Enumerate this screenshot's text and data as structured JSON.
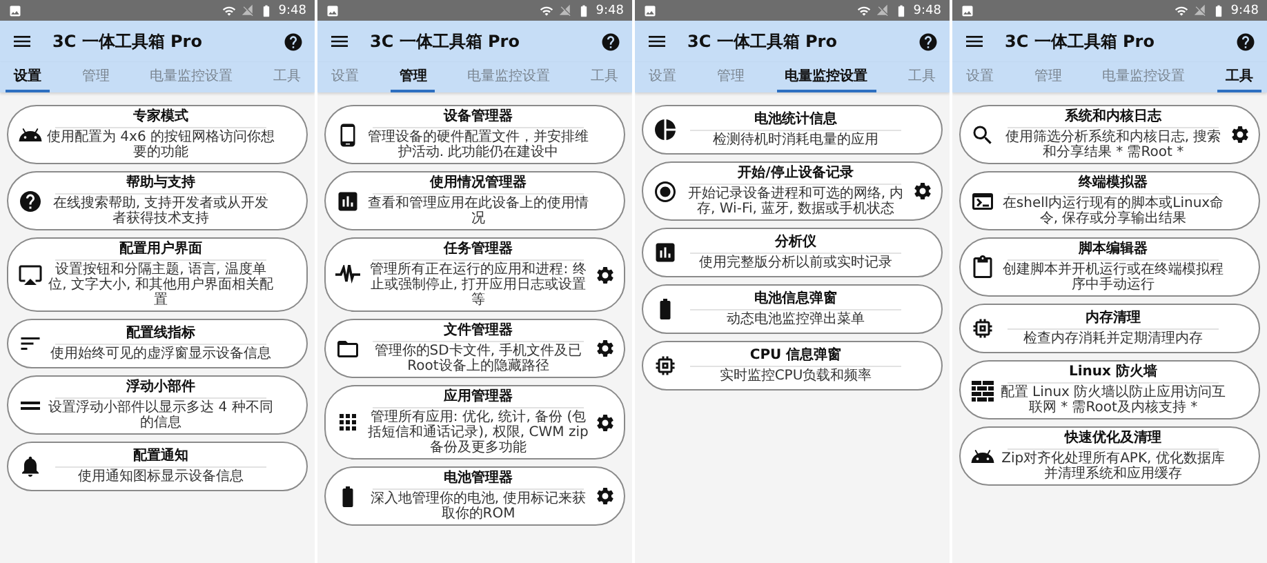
{
  "panels": [
    {
      "status_time": "9:48",
      "app_title": "3C 一体工具箱 Pro",
      "tabs": [
        {
          "label": "设置",
          "selected": true
        },
        {
          "label": "管理",
          "selected": false
        },
        {
          "label": "电量监控设置",
          "selected": false
        },
        {
          "label": "工具",
          "selected": false
        }
      ],
      "cards": [
        {
          "kind": "android",
          "title": "专家模式",
          "description": "使用配置为 4x6 的按钮网格访问你想要的功能",
          "settings": false
        },
        {
          "kind": "help",
          "title": "帮助与支持",
          "description": "在线搜索帮助, 支持开发者或从开发者获得技术支持",
          "settings": false
        },
        {
          "kind": "screen",
          "title": "配置用户界面",
          "description": "设置按钮和分隔主题, 语言, 温度单位, 文字大小, 和其他用户界面相关配置",
          "settings": false
        },
        {
          "kind": "lines",
          "title": "配置线指标",
          "description": "使用始终可见的虚浮窗显示设备信息",
          "settings": false
        },
        {
          "kind": "equals",
          "title": "浮动小部件",
          "description": "设置浮动小部件以显示多达 4 种不同的信息",
          "settings": false
        },
        {
          "kind": "bell",
          "title": "配置通知",
          "description": "使用通知图标显示设备信息",
          "settings": false
        }
      ]
    },
    {
      "status_time": "9:48",
      "app_title": "3C 一体工具箱 Pro",
      "tabs": [
        {
          "label": "设置",
          "selected": false
        },
        {
          "label": "管理",
          "selected": true
        },
        {
          "label": "电量监控设置",
          "selected": false
        },
        {
          "label": "工具",
          "selected": false
        }
      ],
      "cards": [
        {
          "kind": "phone",
          "title": "设备管理器",
          "description": "管理设备的硬件配置文件，并安排维护活动. 此功能仍在建设中",
          "settings": false
        },
        {
          "kind": "bar-chart",
          "title": "使用情况管理器",
          "description": "查看和管理应用在此设备上的使用情况",
          "settings": false
        },
        {
          "kind": "pulse",
          "title": "任务管理器",
          "description": "管理所有正在运行的应用和进程: 终止或强制停止, 打开应用日志或设置等",
          "settings": true
        },
        {
          "kind": "folder",
          "title": "文件管理器",
          "description": "管理你的SD卡文件, 手机文件及已Root设备上的隐藏路径",
          "settings": true
        },
        {
          "kind": "grid",
          "title": "应用管理器",
          "description": "管理所有应用: 优化, 统计, 备份 (包括短信和通话记录), 权限, CWM zip备份及更多功能",
          "settings": true
        },
        {
          "kind": "battery",
          "title": "电池管理器",
          "description": "深入地管理你的电池, 使用标记来获取你的ROM",
          "settings": true
        }
      ]
    },
    {
      "status_time": "9:48",
      "app_title": "3C 一体工具箱 Pro",
      "tabs": [
        {
          "label": "设置",
          "selected": false
        },
        {
          "label": "管理",
          "selected": false
        },
        {
          "label": "电量监控设置",
          "selected": true
        },
        {
          "label": "工具",
          "selected": false
        }
      ],
      "cards": [
        {
          "kind": "pie-chart",
          "title": "电池统计信息",
          "description": "检测待机时消耗电量的应用",
          "settings": false
        },
        {
          "kind": "record",
          "title": "开始/停止设备记录",
          "description": "开始记录设备进程和可选的网络, 内存, Wi-Fi, 蓝牙, 数据或手机状态",
          "settings": true
        },
        {
          "kind": "bar-chart",
          "title": "分析仪",
          "description": "使用完整版分析以前或实时记录",
          "settings": false
        },
        {
          "kind": "battery",
          "title": "电池信息弹窗",
          "description": "动态电池监控弹出菜单",
          "settings": false
        },
        {
          "kind": "chip",
          "title": "CPU 信息弹窗",
          "description": "实时监控CPU负载和频率",
          "settings": false
        }
      ]
    },
    {
      "status_time": "9:48",
      "app_title": "3C 一体工具箱 Pro",
      "tabs": [
        {
          "label": "设置",
          "selected": false
        },
        {
          "label": "管理",
          "selected": false
        },
        {
          "label": "电量监控设置",
          "selected": false
        },
        {
          "label": "工具",
          "selected": true
        }
      ],
      "cards": [
        {
          "kind": "search",
          "title": "系统和内核日志",
          "description": "使用筛选分析系统和内核日志, 搜索和分享结果 * 需Root *",
          "settings": true
        },
        {
          "kind": "terminal",
          "title": "终端模拟器",
          "description": "在shell内运行现有的脚本或Linux命令, 保存或分享输出结果",
          "settings": false
        },
        {
          "kind": "clipboard",
          "title": "脚本编辑器",
          "description": "创建脚本并开机运行或在终端模拟程序中手动运行",
          "settings": false
        },
        {
          "kind": "chip",
          "title": "内存清理",
          "description": "检查内存消耗并定期清理内存",
          "settings": false
        },
        {
          "kind": "wall",
          "title": "Linux 防火墙",
          "description": "配置 Linux 防火墙以防止应用访问互联网 * 需Root及内核支持 *",
          "settings": false
        },
        {
          "kind": "android",
          "title": "快速优化及清理",
          "description": "Zip对齐化处理所有APK, 优化数据库并清理系统和应用缓存",
          "settings": false
        }
      ]
    }
  ]
}
